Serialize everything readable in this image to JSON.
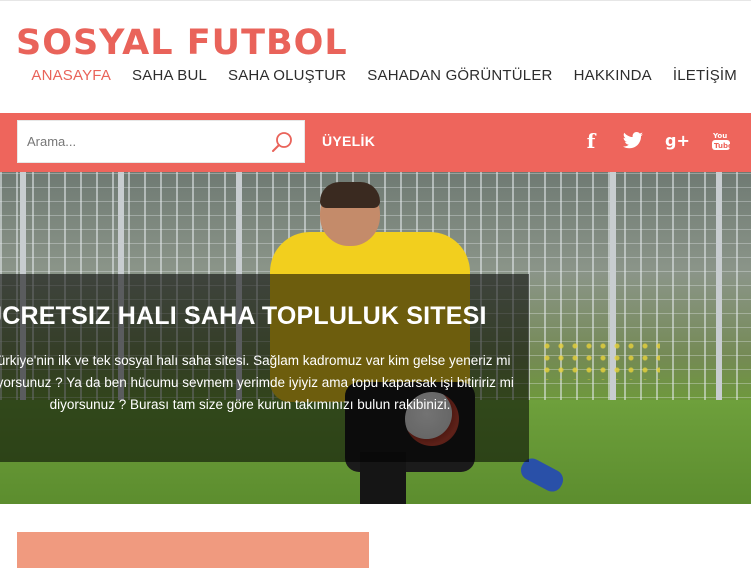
{
  "header": {
    "logo": "SOSYAL FUTBOL",
    "nav": [
      {
        "label": "ANASAYFA",
        "active": true
      },
      {
        "label": "SAHA BUL",
        "active": false
      },
      {
        "label": "SAHA OLUŞTUR",
        "active": false
      },
      {
        "label": "SAHADAN GÖRÜNTÜLER",
        "active": false
      },
      {
        "label": "HAKKINDA",
        "active": false
      },
      {
        "label": "İLETİŞİM",
        "active": false
      }
    ]
  },
  "topbar": {
    "search_placeholder": "Arama...",
    "search_icon": "search-icon",
    "member_label": "ÜYELİK",
    "social": [
      {
        "icon": "facebook-icon",
        "glyph": "f"
      },
      {
        "icon": "twitter-icon",
        "glyph": ""
      },
      {
        "icon": "google-plus-icon",
        "glyph": "g+"
      },
      {
        "icon": "youtube-icon",
        "glyph": ""
      }
    ]
  },
  "hero": {
    "title": "ÜCRETSIZ HALI SAHA TOPLULUK SITESI",
    "lines": [
      "Türkiye'nin ilk ve tek sosyal halı saha sitesi. Sağlam kadromuz var kim gelse yeneriz mi",
      "diyorsunuz ? Ya da ben hücumu sevmem yerimde iyiyiz ama topu kaparsak işi bitiririz mi",
      "diyorsunuz ? Burası tam size göre kurun takımınızı bulun rakibinizi."
    ]
  },
  "colors": {
    "accent": "#ee655c",
    "logo": "#e9635a",
    "card": "#f09a7f"
  }
}
